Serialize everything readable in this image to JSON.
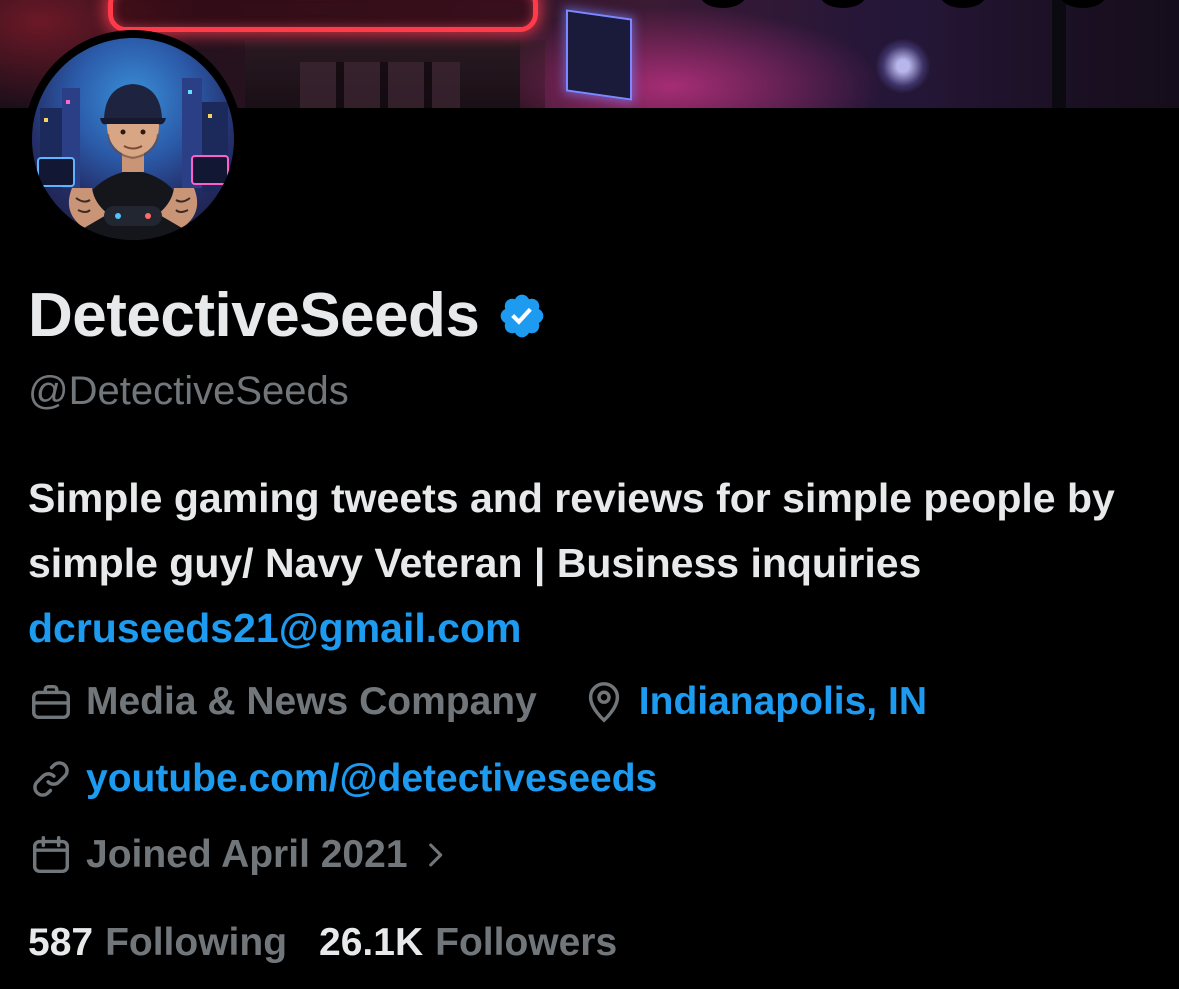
{
  "profile": {
    "display_name": "DetectiveSeeds",
    "handle": "@DetectiveSeeds",
    "bio_text": "Simple gaming tweets and reviews for simple people by simple guy/ Navy Veteran | Business inquiries ",
    "bio_email": "dcruseeds21@gmail.com",
    "category": "Media & News Company",
    "location": "Indianapolis, IN",
    "website": "youtube.com/@detectiveseeds",
    "joined": "Joined April 2021",
    "following_count": "587",
    "following_label": "Following",
    "followers_count": "26.1K",
    "followers_label": "Followers"
  },
  "icons": {
    "verified": "verified-badge-icon",
    "category": "briefcase-icon",
    "location": "location-pin-icon",
    "website": "link-icon",
    "joined": "calendar-icon",
    "joined_more": "chevron-right-icon"
  },
  "colors": {
    "background": "#000000",
    "text_primary": "#e7e9ea",
    "text_secondary": "#71767b",
    "link": "#1d9bf0",
    "verified": "#1d9bf0"
  }
}
